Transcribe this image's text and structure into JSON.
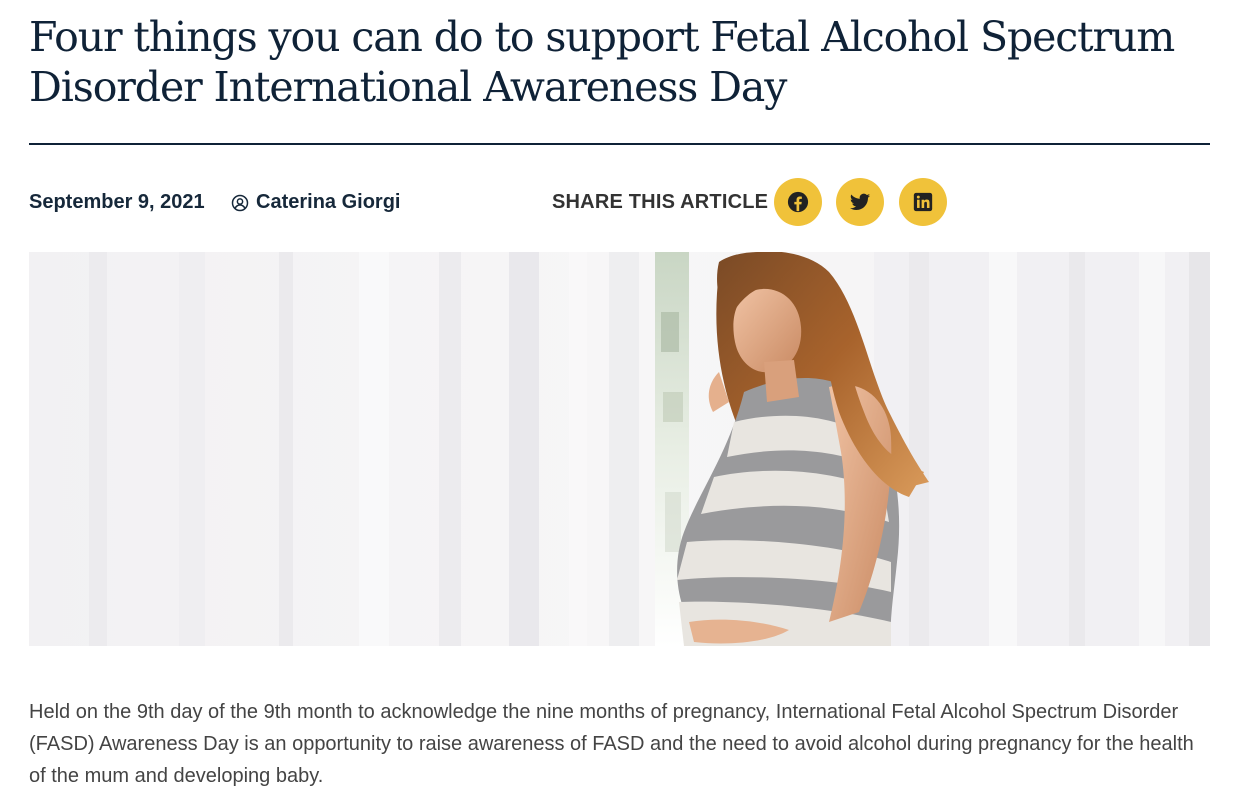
{
  "article": {
    "title": "Four things you can do to support Fetal Alcohol Spectrum Disorder International Awareness Day",
    "date": "September 9, 2021",
    "author": "Caterina Giorgi",
    "body": "Held on the 9th day of the 9th month to acknowledge the nine months of pregnancy, International Fetal Alcohol Spectrum Disorder (FASD) Awareness Day is an opportunity to raise awareness of FASD and the need to avoid alcohol during pregnancy for the health of the mum and developing baby."
  },
  "share": {
    "label": "SHARE THIS ARTICLE",
    "buttons": [
      {
        "icon": "facebook-icon"
      },
      {
        "icon": "twitter-icon"
      },
      {
        "icon": "linkedin-icon"
      }
    ]
  },
  "colors": {
    "heading": "#0f2237",
    "accent": "#f0c23a",
    "body_text": "#444444"
  },
  "hero": {
    "icon": "pregnant-woman-photo"
  }
}
